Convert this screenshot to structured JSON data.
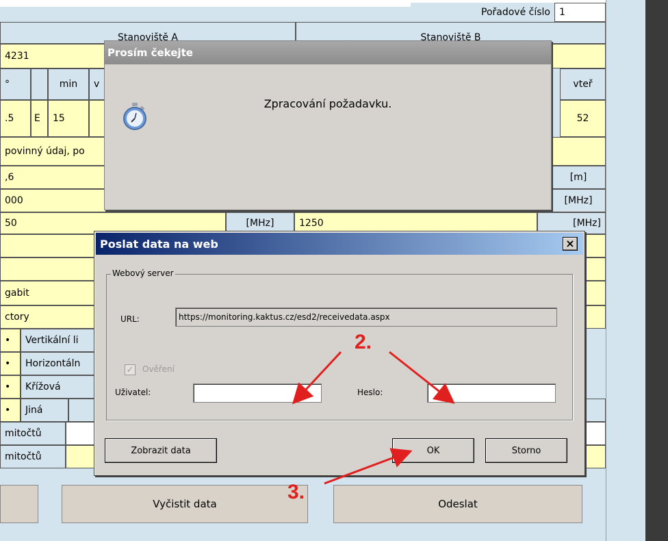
{
  "form": {
    "poradove_label": "Pořadové číslo",
    "poradove_value": "1",
    "stanoviste_a": "Stanoviště A",
    "stanoviste_b": "Stanoviště B",
    "row_id": "4231",
    "deg_sym": "°",
    "min_label": "min",
    "vter_label_partial": "v",
    "vter_label": "vteř",
    "coord_val1": ".5",
    "coord_dir": "E",
    "coord_min": "15",
    "coord_sec_b": "52",
    "povinny": "povinný údaj, po",
    "height_a": ",6",
    "height_unit": "[m]",
    "freq_a": "000",
    "freq_unit": "[MHz]",
    "freq_a2": "50",
    "freq_unit_mid": "[MHz]",
    "freq_b2": "1250",
    "freq_unit_b": "[MHz]",
    "gigabit": "gabit",
    "factory": "ctory",
    "pol_vertical": "Vertikální li",
    "pol_horizontal": "Horizontáln",
    "pol_cross": "Křížová",
    "pol_other": "Jiná",
    "kmitoctu_1": "mitočtů",
    "kmitoctu_2": "mitočtů",
    "btn_clear": "Vyčistit data",
    "btn_send": "Odeslat"
  },
  "wait_dialog": {
    "title": "Prosím čekejte",
    "message": "Zpracování požadavku."
  },
  "web_dialog": {
    "title": "Poslat data na web",
    "close": "×",
    "group": "Webový server",
    "url_label": "URL:",
    "url_value": "https://monitoring.kaktus.cz/esd2/receivedata.aspx",
    "auth_label": "Ověření",
    "user_label": "Uživatel:",
    "pass_label": "Heslo:",
    "user_value": "",
    "pass_value": "",
    "show_data": "Zobrazit data",
    "ok": "OK",
    "cancel": "Storno"
  },
  "annotations": {
    "step2": "2.",
    "step3": "3."
  }
}
